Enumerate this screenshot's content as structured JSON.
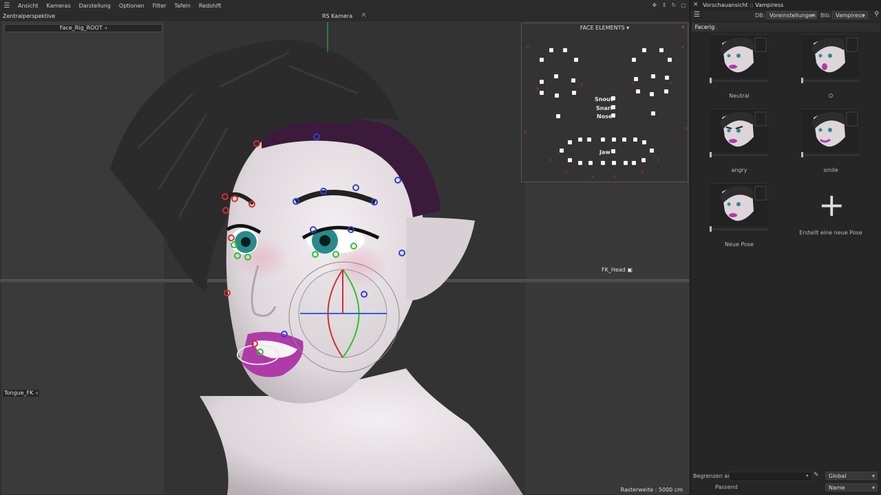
{
  "menubar": {
    "items": [
      "Ansicht",
      "Kameras",
      "Darstellung",
      "Optionen",
      "Filter",
      "Tafeln",
      "Redshift"
    ]
  },
  "viewport": {
    "projection": "Zentralperspektive",
    "camera": "RS Kamera",
    "root_control": "Face_Rig_ROOT",
    "tongue_control": "Tongue_FK",
    "head_control": "FK_Head",
    "raster": "Rasterweite : 5000 cm"
  },
  "face_panel": {
    "title": "FACE ELEMENTS",
    "labels": {
      "snout": "Snout",
      "snarl": "Snarl",
      "nose": "Nose",
      "jaw": "Jaw"
    }
  },
  "pose_panel": {
    "title": "Vorschauansicht :: Vampiress",
    "db_label": "DB:",
    "db_value": "Voreinstellungen",
    "bib_label": "Bib:",
    "bib_value": "Vampiress",
    "tab": "Facerig",
    "poses": [
      {
        "label": "Neutral"
      },
      {
        "label": "O"
      },
      {
        "label": "angry"
      },
      {
        "label": "smile"
      },
      {
        "label": "Neue Pose"
      }
    ],
    "new_pose": "Erstellt eine neue Pose",
    "limit_label": "Begrenzen auf",
    "scope_value": "Global",
    "match_label": "Passend",
    "sort_value": "Name"
  },
  "colors": {
    "skin": "#e8e2e6",
    "hair": "#2d2d2d",
    "hair_purple": "#3d1a3d",
    "lips": "#b03aa8",
    "iris": "#2a8a8a",
    "ctrl_red": "#d03030",
    "ctrl_blue": "#3040d0",
    "ctrl_green": "#30c030"
  }
}
